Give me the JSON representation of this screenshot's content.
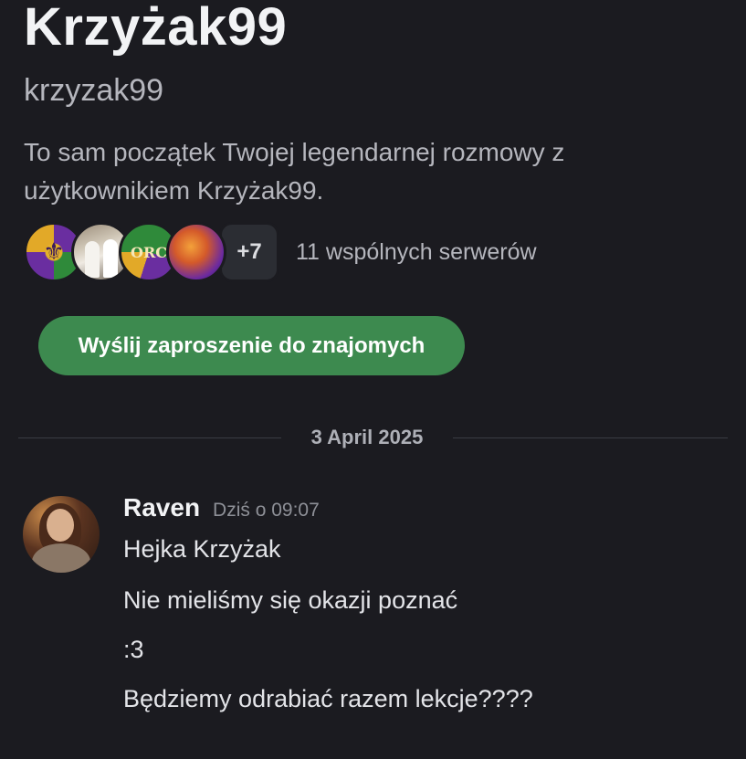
{
  "profile": {
    "display_name": "Krzyżak99",
    "username": "krzyzak99",
    "intro": "To sam początek Twojej legendarnej rozmowy z użytkownikiem Krzyżak99.",
    "mutual_servers": {
      "icons": [
        "server-icon-fleur",
        "server-icon-group-photo",
        "server-icon-orc",
        "server-icon-fire"
      ],
      "more_count": "+7",
      "label": "11 wspólnych serwerów"
    },
    "friend_button_label": "Wyślij zaproszenie do znajomych"
  },
  "divider": {
    "date": "3 April 2025"
  },
  "message_group": {
    "author": "Raven",
    "timestamp": "Dziś o 09:07",
    "messages": [
      "Hejka Krzyżak",
      "Nie mieliśmy się okazji poznać",
      ":3",
      "Będziemy odrabiać razem lekcje????"
    ]
  },
  "colors": {
    "background": "#1b1b20",
    "accent_green": "#3d8a4f",
    "muted_text": "#b5b6bd"
  }
}
